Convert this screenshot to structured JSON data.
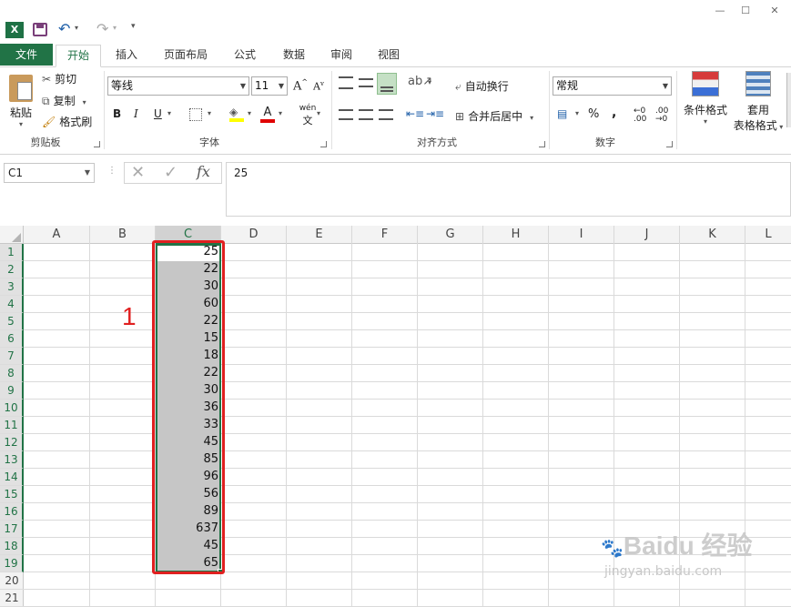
{
  "qat": {
    "logo": "excel-logo",
    "save": "save-icon",
    "undo": "undo-icon",
    "redo": "redo-icon",
    "customize": "customize-qat-icon"
  },
  "window_controls": {
    "minimize": "—",
    "restore": "☐",
    "close": "✕"
  },
  "tabs": [
    {
      "label": "文件"
    },
    {
      "label": "开始"
    },
    {
      "label": "插入"
    },
    {
      "label": "页面布局"
    },
    {
      "label": "公式"
    },
    {
      "label": "数据"
    },
    {
      "label": "审阅"
    },
    {
      "label": "视图"
    }
  ],
  "ribbon": {
    "clipboard": {
      "paste": "粘贴",
      "cut": "剪切",
      "copy": "复制",
      "format_painter": "格式刷",
      "label": "剪贴板"
    },
    "font": {
      "name": "等线",
      "size": "11",
      "bold": "B",
      "italic": "I",
      "underline": "U",
      "font_color": "A",
      "phonetic": "wén",
      "grow": "A",
      "shrink": "A",
      "label": "字体"
    },
    "alignment": {
      "wrap_text": "自动换行",
      "merge_center": "合并后居中",
      "label": "对齐方式"
    },
    "number": {
      "format": "常规",
      "percent": "%",
      "comma": ",",
      "label": "数字",
      "inc_dec": ".00",
      "dec_dec": ".00"
    },
    "styles": {
      "conditional": "条件格式",
      "table_format_1": "套用",
      "table_format_2": "表格格式"
    }
  },
  "formula_bar": {
    "name_box": "C1",
    "cancel": "✕",
    "enter": "✓",
    "fx": "fx",
    "value": "25"
  },
  "columns": [
    "A",
    "B",
    "C",
    "D",
    "E",
    "F",
    "G",
    "H",
    "I",
    "J",
    "K",
    "L"
  ],
  "rows": [
    "1",
    "2",
    "3",
    "4",
    "5",
    "6",
    "7",
    "8",
    "9",
    "10",
    "11",
    "12",
    "13",
    "14",
    "15",
    "16",
    "17",
    "18",
    "19",
    "20",
    "21"
  ],
  "column_c_values": [
    "25",
    "22",
    "30",
    "60",
    "22",
    "15",
    "18",
    "22",
    "30",
    "36",
    "33",
    "45",
    "85",
    "96",
    "56",
    "89",
    "637",
    "45",
    "65"
  ],
  "annotation": {
    "label": "1",
    "color": "#e02020"
  },
  "watermark": {
    "brand": "Baidu 经验",
    "url": "jingyan.baidu.com"
  },
  "colors": {
    "accent": "#217346",
    "selection": "#c6c6c6"
  }
}
